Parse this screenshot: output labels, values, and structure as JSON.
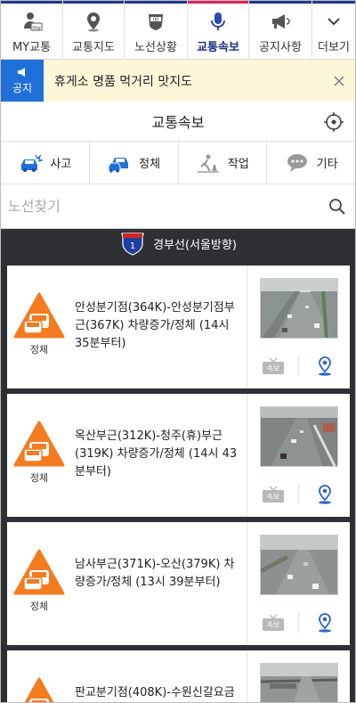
{
  "nav": {
    "items": [
      {
        "label": "MY교통",
        "icon": "my-traffic-icon"
      },
      {
        "label": "교통지도",
        "icon": "map-pin-icon"
      },
      {
        "label": "노선상황",
        "icon": "route-status-icon"
      },
      {
        "label": "교통속보",
        "icon": "microphone-icon"
      },
      {
        "label": "공지사항",
        "icon": "megaphone-icon"
      },
      {
        "label": "더보기",
        "icon": "chevron-down-icon"
      }
    ],
    "active_index": 3,
    "colors": {
      "top_bar": "#1f3a8a",
      "active": "#d8245a"
    }
  },
  "notice": {
    "badge_label": "공지",
    "text": "휴게소 명품 먹거리 맛지도",
    "colors": {
      "badge": "#1f6fd8",
      "background": "#fdf6d9"
    }
  },
  "page": {
    "title": "교통속보"
  },
  "categories": [
    {
      "label": "사고",
      "icon": "accident-car-icon"
    },
    {
      "label": "정체",
      "icon": "congestion-car-icon"
    },
    {
      "label": "작업",
      "icon": "roadwork-icon"
    },
    {
      "label": "기타",
      "icon": "speech-bubble-icon"
    }
  ],
  "search": {
    "placeholder": "노선찾기",
    "value": ""
  },
  "route": {
    "shield_number": "1",
    "name": "경부선(서울방향)"
  },
  "incidents": [
    {
      "status": "정체",
      "text": "안성분기점(364K)-안성분기점부근(367K) 차량증가/정체 (14시 35분부터)"
    },
    {
      "status": "정체",
      "text": "옥산부근(312K)-청주(휴)부근(319K) 차량증가/정체 (14시 43분부터)"
    },
    {
      "status": "정체",
      "text": "남사부근(371K)-오산(379K) 차량증가/정체 (13시 39분부터)"
    },
    {
      "status": "",
      "text": "판교분기점(408K)-수원신갈요금"
    }
  ],
  "card_actions": {
    "broadcast_label": "속보"
  }
}
